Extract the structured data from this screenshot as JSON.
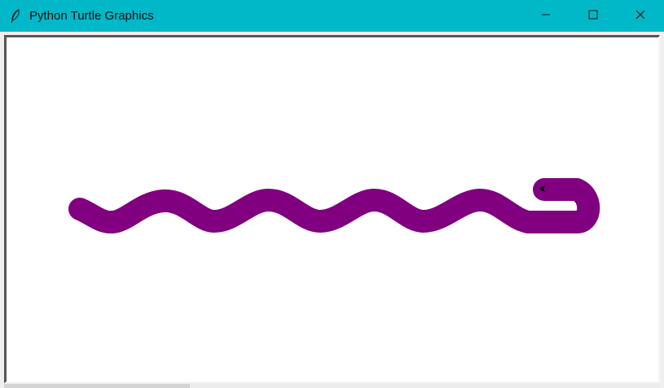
{
  "window": {
    "title": "Python Turtle Graphics",
    "icon": "feather-icon",
    "titlebar_color": "#00b8c8",
    "controls": [
      {
        "name": "minimize",
        "icon": "minimize-icon"
      },
      {
        "name": "maximize",
        "icon": "maximize-icon"
      },
      {
        "name": "close",
        "icon": "close-icon"
      }
    ]
  },
  "canvas": {
    "background": "#ffffff",
    "pen_color": "#800080",
    "pen_color_name": "purple",
    "turtle_shape": "classic-arrow",
    "turtle_color": "#000000"
  }
}
